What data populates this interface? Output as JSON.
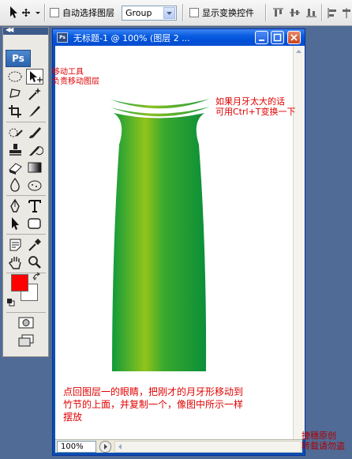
{
  "options_bar": {
    "auto_select_label": "自动选择图层",
    "auto_select_checked": false,
    "group_select_value": "Group",
    "show_transform_label": "显示变换控件",
    "show_transform_checked": false,
    "tool_icon": "move-tool-icon"
  },
  "tool_panel": {
    "logo": "Ps",
    "foreground_color": "#ff0000",
    "background_color": "#ffffff",
    "selected_tool": "move-tool"
  },
  "document": {
    "title": "无标题-1 @ 100% (图层 2 ...",
    "zoom": "100%",
    "canvas_background": "#ffffff",
    "bamboo_colors": [
      "#0f9a3a",
      "#92c41a"
    ]
  },
  "annotations": {
    "move_tool_line1": "移动工具",
    "move_tool_line2": "负责移动图层",
    "crescent_line1": "如果月牙太大的话",
    "crescent_line2": "可用Ctrl+T变换一下",
    "bottom_line1": "点回图层一的眼睛，把刚才的月牙形移动到",
    "bottom_line2": "竹节的上面，并复制一个，像图中所示一样",
    "bottom_line3": "摆放",
    "watermark_line1": "捷穗原创",
    "watermark_line2": "转载请勿盗"
  }
}
